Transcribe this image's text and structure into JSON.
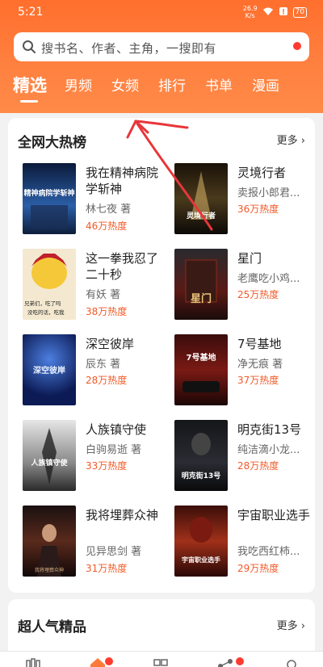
{
  "status_bar": {
    "time": "5:21",
    "net_speed_value": "26.9",
    "net_speed_unit": "K/s",
    "battery": "70"
  },
  "search": {
    "placeholder": "搜书名、作者、主角，一搜即有"
  },
  "tabs": [
    {
      "label": "精选",
      "active": true
    },
    {
      "label": "男频",
      "active": false
    },
    {
      "label": "女频",
      "active": false
    },
    {
      "label": "排行",
      "active": false
    },
    {
      "label": "书单",
      "active": false
    },
    {
      "label": "漫画",
      "active": false
    }
  ],
  "hot_list": {
    "title": "全网大热榜",
    "more": "更多",
    "books": [
      {
        "title": "我在精神病院学斩神",
        "author": "林七夜 著",
        "heat": "46万热度"
      },
      {
        "title": "灵境行者",
        "author": "卖报小郎君...",
        "heat": "36万热度"
      },
      {
        "title": "这一拳我忍了二十秒",
        "author": "有妖 著",
        "heat": "38万热度"
      },
      {
        "title": "星门",
        "author": "老鹰吃小鸡...",
        "heat": "25万热度"
      },
      {
        "title": "深空彼岸",
        "author": "辰东 著",
        "heat": "28万热度"
      },
      {
        "title": "7号基地",
        "author": "净无痕 著",
        "heat": "37万热度"
      },
      {
        "title": "人族镇守使",
        "author": "白驹易逝 著",
        "heat": "33万热度"
      },
      {
        "title": "明克街13号",
        "author": "纯洁滴小龙...",
        "heat": "28万热度"
      },
      {
        "title": "我将埋葬众神",
        "author": "见异思剑 著",
        "heat": "31万热度"
      },
      {
        "title": "宇宙职业选手",
        "author": "我吃西红柿...",
        "heat": "29万热度"
      }
    ]
  },
  "cover_text": [
    "精神病院学斩神",
    "灵境行者",
    "兄弟们，吃了吗",
    "没吃的话，吃我",
    "星门",
    "深空彼岸",
    "7号基地",
    "人族镇守使",
    "明克街13号",
    "我将埋葬众神",
    "宇宙职业选手"
  ],
  "popular": {
    "title": "超人气精品",
    "more": "更多"
  },
  "colors": {
    "brand": "#ff7a38",
    "heat": "#f05a28",
    "badge": "#ff3b30"
  },
  "icons": [
    "search-icon",
    "chevron-right-icon",
    "bookshelf-icon",
    "home-icon",
    "category-icon",
    "community-icon",
    "profile-icon"
  ]
}
